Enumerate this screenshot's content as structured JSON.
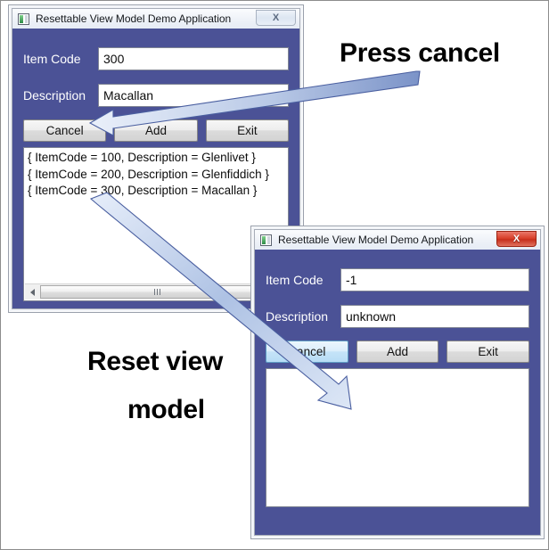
{
  "page": {
    "background_color": "#ffffff",
    "border_color": "#8c8c8c"
  },
  "colors": {
    "form_background": "#4b5296",
    "titlebar_light": "#eef2f8",
    "close_active_red": "#d9412c",
    "button_face": "#ededed",
    "focus_blue": "#c5e4f8",
    "arrow_fill_light": "#dce6f4",
    "arrow_stroke": "#4a5fa0"
  },
  "window_main": {
    "icon": "app-icon",
    "title": "Resettable View Model Demo Application",
    "close_button": {
      "icon": "close-icon",
      "label": "X",
      "state": "inactive"
    },
    "fields": [
      {
        "label": "Item Code",
        "value": "300",
        "placeholder": ""
      },
      {
        "label": "Description",
        "value": "Macallan",
        "placeholder": ""
      }
    ],
    "buttons": [
      {
        "label": "Cancel",
        "focused": false
      },
      {
        "label": "Add",
        "focused": false
      },
      {
        "label": "Exit",
        "focused": false
      }
    ],
    "list_items": [
      "{ ItemCode = 100, Description = Glenlivet }",
      "{ ItemCode = 200, Description = Glenfiddich }",
      "{ ItemCode = 300, Description = Macallan }"
    ],
    "scrollbar": {
      "left_arrow_icon": "caret-left-icon",
      "grip_icon": "grip-icon"
    }
  },
  "window_reset": {
    "icon": "app-icon",
    "title": "Resettable View Model Demo Application",
    "close_button": {
      "icon": "close-icon",
      "label": "X",
      "state": "active"
    },
    "fields": [
      {
        "label": "Item Code",
        "value": "-1",
        "placeholder": ""
      },
      {
        "label": "Description",
        "value": "unknown",
        "placeholder": ""
      }
    ],
    "buttons": [
      {
        "label": "Cancel",
        "focused": true
      },
      {
        "label": "Add",
        "focused": false
      },
      {
        "label": "Exit",
        "focused": false
      }
    ],
    "list_items": []
  },
  "annotations": {
    "press_cancel": "Press cancel",
    "reset_view_line1": "Reset view",
    "reset_view_line2": "model"
  }
}
